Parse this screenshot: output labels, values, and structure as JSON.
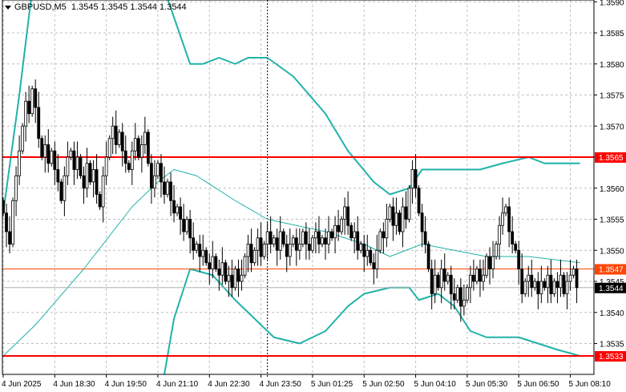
{
  "header": {
    "symbol": "GBPUSD,M5",
    "ohlc": "1.3545 1.3545 1.3544 1.3544"
  },
  "colors": {
    "grid": "#c0c0c0",
    "band": "#20b2aa",
    "red_line": "#ff0000",
    "orange_line": "#ff4500",
    "bull_body": "#ffffff",
    "bear_body": "#000000",
    "bid_tag": "#000000"
  },
  "chart_data": {
    "type": "candlestick",
    "price_axis": {
      "min": 1.35305,
      "max": 1.35905,
      "ticks": [
        "1.3590",
        "1.3585",
        "1.3580",
        "1.3575",
        "1.3570",
        "1.3565",
        "1.3560",
        "1.3555",
        "1.3550",
        "1.3545",
        "1.3540",
        "1.3535"
      ]
    },
    "time_axis": {
      "labels": [
        {
          "i": 0,
          "label": "4 Jun 2025"
        },
        {
          "i": 16,
          "label": "4 Jun 18:30"
        },
        {
          "i": 32,
          "label": "4 Jun 19:50"
        },
        {
          "i": 48,
          "label": "4 Jun 21:10"
        },
        {
          "i": 64,
          "label": "4 Jun 22:30"
        },
        {
          "i": 80,
          "label": "4 Jun 23:50"
        },
        {
          "i": 96,
          "label": "5 Jun 01:25"
        },
        {
          "i": 112,
          "label": "5 Jun 02:50"
        },
        {
          "i": 128,
          "label": "5 Jun 04:10"
        },
        {
          "i": 144,
          "label": "5 Jun 05:30"
        },
        {
          "i": 160,
          "label": "5 Jun 06:50"
        },
        {
          "i": 176,
          "label": "5 Jun 08:10"
        }
      ],
      "crosshair_i": 82
    },
    "closes": [
      1.3556,
      1.3553,
      1.3551,
      1.3558,
      1.3562,
      1.3566,
      1.357,
      1.3574,
      1.3572,
      1.3576,
      1.3573,
      1.3568,
      1.3565,
      1.3567,
      1.3564,
      1.3566,
      1.3563,
      1.3561,
      1.3558,
      1.3562,
      1.3565,
      1.3566,
      1.3563,
      1.3565,
      1.3562,
      1.356,
      1.3564,
      1.3561,
      1.3563,
      1.3559,
      1.3557,
      1.3562,
      1.3565,
      1.3568,
      1.357,
      1.3567,
      1.3569,
      1.3566,
      1.3564,
      1.3563,
      1.3566,
      1.3568,
      1.3565,
      1.3567,
      1.3569,
      1.3564,
      1.356,
      1.3562,
      1.3564,
      1.3561,
      1.3559,
      1.3561,
      1.3558,
      1.3556,
      1.3557,
      1.3555,
      1.3553,
      1.3555,
      1.3552,
      1.355,
      1.3551,
      1.3549,
      1.355,
      1.3548,
      1.3547,
      1.3549,
      1.3547,
      1.3546,
      1.3548,
      1.3545,
      1.3546,
      1.3544,
      1.3547,
      1.3545,
      1.3546,
      1.3549,
      1.3551,
      1.3548,
      1.355,
      1.3552,
      1.3549,
      1.3551,
      1.3553,
      1.3551,
      1.3552,
      1.355,
      1.3553,
      1.3551,
      1.3549,
      1.3551,
      1.3552,
      1.355,
      1.3551,
      1.3553,
      1.3551,
      1.355,
      1.3552,
      1.3553,
      1.3551,
      1.3552,
      1.3551,
      1.3553,
      1.3552,
      1.3554,
      1.3553,
      1.3555,
      1.3557,
      1.3554,
      1.3552,
      1.3553,
      1.355,
      1.3551,
      1.3549,
      1.355,
      1.3548,
      1.3547,
      1.355,
      1.3553,
      1.3552,
      1.3555,
      1.3557,
      1.3554,
      1.3556,
      1.3553,
      1.3557,
      1.3555,
      1.356,
      1.3563,
      1.356,
      1.3556,
      1.3553,
      1.3551,
      1.3547,
      1.3543,
      1.3546,
      1.3544,
      1.3547,
      1.3545,
      1.3546,
      1.3543,
      1.3542,
      1.3544,
      1.3541,
      1.3542,
      1.3544,
      1.3546,
      1.3545,
      1.3547,
      1.3545,
      1.3546,
      1.3549,
      1.3547,
      1.3549,
      1.3551,
      1.3554,
      1.3556,
      1.3557,
      1.3553,
      1.3551,
      1.355,
      1.3547,
      1.3543,
      1.3545,
      1.3546,
      1.3544,
      1.3545,
      1.3543,
      1.3545,
      1.3544,
      1.3546,
      1.3543,
      1.3545,
      1.3544,
      1.3546,
      1.3543,
      1.3545,
      1.3546,
      1.3547,
      1.3544
    ],
    "bands": {
      "upper": [
        [
          0,
          1.3556
        ],
        [
          5,
          1.3575
        ],
        [
          9,
          1.3592
        ],
        [
          50,
          1.3592
        ],
        [
          58,
          1.358
        ],
        [
          62,
          1.358
        ],
        [
          67,
          1.3581
        ],
        [
          72,
          1.358
        ],
        [
          76,
          1.3581
        ],
        [
          82,
          1.3581
        ],
        [
          90,
          1.3578
        ],
        [
          100,
          1.3572
        ],
        [
          107,
          1.3566
        ],
        [
          115,
          1.3561
        ],
        [
          120,
          1.3559
        ],
        [
          126,
          1.356
        ],
        [
          130,
          1.3563
        ],
        [
          138,
          1.3563
        ],
        [
          148,
          1.3563
        ],
        [
          155,
          1.3564
        ],
        [
          163,
          1.3565
        ],
        [
          168,
          1.3564
        ],
        [
          179,
          1.3564
        ]
      ],
      "middle": [
        [
          0,
          1.3533
        ],
        [
          10,
          1.3538
        ],
        [
          25,
          1.3547
        ],
        [
          40,
          1.3557
        ],
        [
          48,
          1.3561
        ],
        [
          53,
          1.3563
        ],
        [
          60,
          1.3562
        ],
        [
          72,
          1.3558
        ],
        [
          82,
          1.3555
        ],
        [
          100,
          1.3553
        ],
        [
          112,
          1.3551
        ],
        [
          120,
          1.3549
        ],
        [
          130,
          1.3551
        ],
        [
          140,
          1.355
        ],
        [
          150,
          1.3549
        ],
        [
          163,
          1.3549
        ],
        [
          179,
          1.3548
        ]
      ],
      "lower": [
        [
          50,
          1.353
        ],
        [
          53,
          1.3539
        ],
        [
          58,
          1.3547
        ],
        [
          65,
          1.3546
        ],
        [
          72,
          1.3542
        ],
        [
          84,
          1.3536
        ],
        [
          92,
          1.3535
        ],
        [
          100,
          1.3537
        ],
        [
          107,
          1.3541
        ],
        [
          112,
          1.3543
        ],
        [
          120,
          1.3544
        ],
        [
          126,
          1.3544
        ],
        [
          129,
          1.3542
        ],
        [
          135,
          1.3543
        ],
        [
          140,
          1.3541
        ],
        [
          145,
          1.3537
        ],
        [
          150,
          1.3536
        ],
        [
          160,
          1.3536
        ],
        [
          172,
          1.3534
        ],
        [
          179,
          1.3533
        ]
      ]
    },
    "levels": [
      {
        "price": 1.3565,
        "label": "1.3565",
        "kind": "red"
      },
      {
        "price": 1.3533,
        "label": "1.3533",
        "kind": "red"
      },
      {
        "price": 1.3547,
        "label": "1.3547",
        "kind": "orange"
      }
    ],
    "bid": {
      "price": 1.3544,
      "label": "1.3544"
    }
  }
}
